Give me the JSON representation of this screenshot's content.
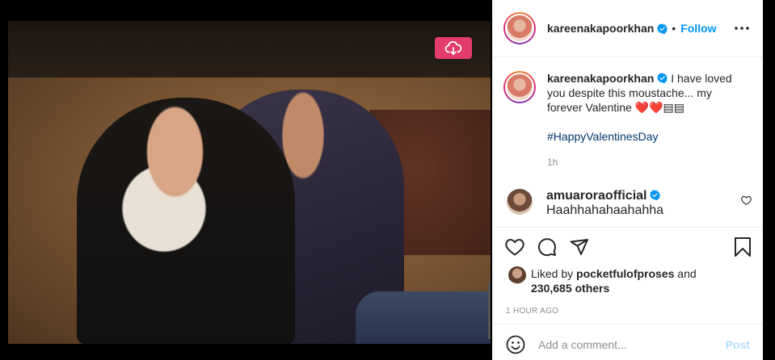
{
  "post": {
    "author": "kareenakapoorkhan",
    "follow_label": "Follow",
    "dot": "•",
    "caption": "I have loved you despite this moustache... my forever Valentine ❤️❤️▤▤",
    "hashtag": "#HappyValentinesDay",
    "caption_age": "1h"
  },
  "comments": [
    {
      "user": "amuarorao fficial",
      "display_user": "amuaroraofficial",
      "text": "Haahhahahaahahha"
    }
  ],
  "likes": {
    "prefix": "Liked by",
    "user": "pocketfulofproses",
    "and": "and",
    "count": "230,685 others"
  },
  "timestamp": "1 HOUR AGO",
  "comment_box": {
    "placeholder": "Add a comment...",
    "post_label": "Post"
  },
  "colors": {
    "accent": "#0095f6",
    "hashtag": "#00376b",
    "download_button": "#e33b6b",
    "post_disabled": "#b2dffc"
  },
  "icons": [
    "download-cloud-icon",
    "verified-badge-icon",
    "more-options-icon",
    "heart-icon",
    "comment-icon",
    "share-icon",
    "bookmark-icon",
    "emoji-icon"
  ]
}
